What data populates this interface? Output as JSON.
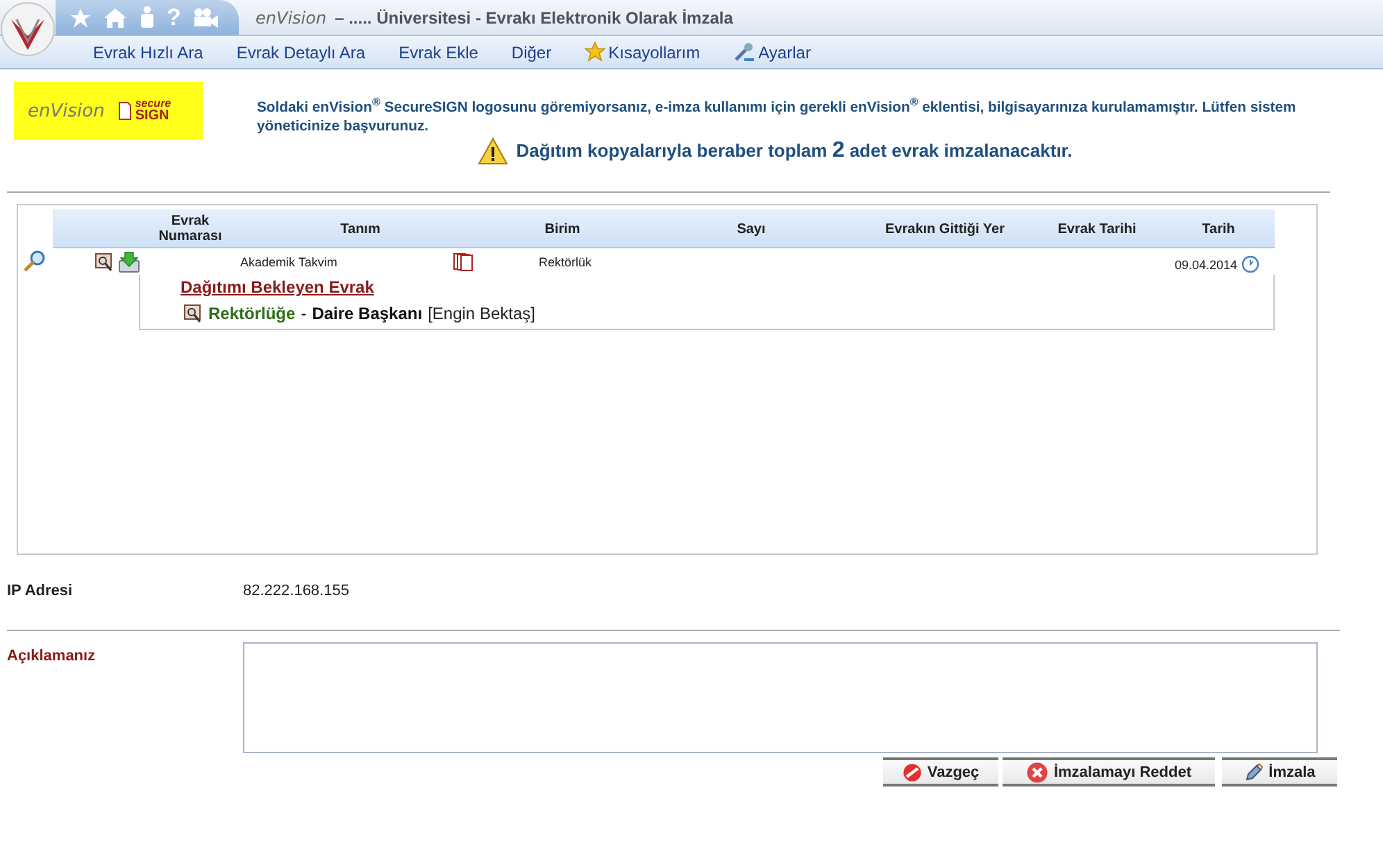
{
  "header": {
    "brand": "enVision",
    "title": "– ..... Üniversitesi - Evrakı Elektronik Olarak İmzala",
    "quick_icons": [
      {
        "kind": "star"
      },
      {
        "kind": "home"
      },
      {
        "kind": "person"
      },
      {
        "kind": "help",
        "glyph": "?"
      },
      {
        "kind": "camera"
      }
    ],
    "menu": [
      {
        "label": "Evrak Hızlı Ara",
        "kind": "plain"
      },
      {
        "label": "Evrak Detaylı Ara",
        "kind": "plain"
      },
      {
        "label": "Evrak Ekle",
        "kind": "plain"
      },
      {
        "label": "Diğer",
        "kind": "plain"
      },
      {
        "label": "Kısayollarım",
        "kind": "star"
      },
      {
        "label": "Ayarlar",
        "kind": "tools"
      }
    ]
  },
  "secure_logo": {
    "brand": "enVision",
    "badge_top": "secure",
    "badge_bottom": "SIGN"
  },
  "notice": "Soldaki enVision$^{®}$ SecureSIGN logosunu göremiyorsanız, e-imza kullanımı için gerekli enVision$^{®}$ eklentisi, bilgisayarınıza kurulamamıştır. Lütfen sistem yöneticinize başvurunuz.",
  "warning": "Dağıtım kopyalarıyla beraber toplam **2** adet evrak imzalanacaktır.",
  "table": {
    "columns": [
      "Evrak Numarası",
      "Tanım",
      "Birim",
      "Sayı",
      "Evrakın Gittiği Yer",
      "Evrak Tarihi",
      "Tarih"
    ],
    "rows": [
      {
        "description": "Akademik Takvim",
        "unit": "Rektörlük",
        "date": "09.04.2014",
        "distribution": {
          "title": "Dağıtımı Bekleyen Evrak",
          "target": "Rektörlüğe",
          "separator": "-",
          "role": "Daire Başkanı",
          "person": "[Engin Bektaş]"
        }
      }
    ]
  },
  "ip": {
    "label": "IP Adresi",
    "value": "82.222.168.155"
  },
  "comment": {
    "label": "Açıklamanız"
  },
  "buttons": [
    {
      "label": "Vazgeç",
      "kind": "cancel"
    },
    {
      "label": "İmzalamayı Reddet",
      "kind": "reject"
    },
    {
      "label": "İmzala",
      "kind": "sign"
    }
  ]
}
